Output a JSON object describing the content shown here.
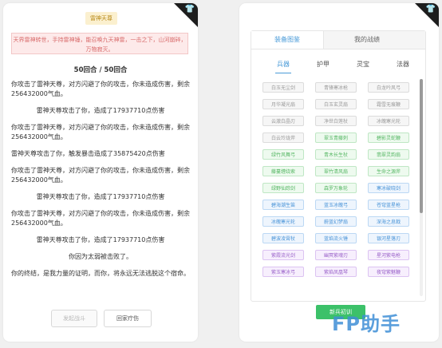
{
  "left": {
    "title": "雷神天尊",
    "banner": "天界雷神转世，手持雷神锤，能召唤九天神雷，一击之下，山河崩碎，万物寂灭。",
    "round": "50回合 / 50回合",
    "log": [
      "你攻击了雷神天尊，对方闪避了你的攻击，你未造成伤害，剩余256432000气血。",
      "雷神天尊攻击了你，造成了17937710点伤害",
      "你攻击了雷神天尊，对方闪避了你的攻击，你未造成伤害，剩余256432000气血。",
      "雷神天尊攻击了你，触发暴击造成了35875420点伤害",
      "你攻击了雷神天尊，对方闪避了你的攻击，你未造成伤害，剩余256432000气血。",
      "雷神天尊攻击了你，造成了17937710点伤害",
      "你攻击了雷神天尊，对方闪避了你的攻击，你未造成伤害，剩余256432000气血。",
      "雷神天尊攻击了你，造成了17937710点伤害",
      "你因为太弱被击败了。",
      "你的终结，是我力量的证明，而你，将永远无法逃脱这个宿命。"
    ],
    "buttons": {
      "attack": "发起战斗",
      "back": "回家疗伤"
    }
  },
  "right": {
    "top_tabs": [
      "装备图鉴",
      "我的战绩"
    ],
    "sub_tabs": [
      "兵器",
      "护甲",
      "灵宝",
      "法器"
    ],
    "items": [
      {
        "label": "白玉无尘剑",
        "tier": "white"
      },
      {
        "label": "青锋寒冰枪",
        "tier": "white"
      },
      {
        "label": "白龙吟风弓",
        "tier": "white"
      },
      {
        "label": "月华凝光扇",
        "tier": "white"
      },
      {
        "label": "白玉玄灵扇",
        "tier": "white"
      },
      {
        "label": "霜雪无痕鞭",
        "tier": "white"
      },
      {
        "label": "云澈白晶刃",
        "tier": "white"
      },
      {
        "label": "净世白莲杖",
        "tier": "white"
      },
      {
        "label": "冰魄寒光轮",
        "tier": "white"
      },
      {
        "label": "白云玲珑斧",
        "tier": "white"
      },
      {
        "label": "翠玉青藤刺",
        "tier": "green"
      },
      {
        "label": "碧影灵蛇鞭",
        "tier": "green"
      },
      {
        "label": "绿竹风舞弓",
        "tier": "green"
      },
      {
        "label": "青木长生杖",
        "tier": "green"
      },
      {
        "label": "翡翠灵韵扇",
        "tier": "green"
      },
      {
        "label": "藤蔓缠绕索",
        "tier": "green"
      },
      {
        "label": "翠竹清风扇",
        "tier": "green"
      },
      {
        "label": "生命之源斧",
        "tier": "green"
      },
      {
        "label": "绿野仙踪剑",
        "tier": "green"
      },
      {
        "label": "森罗万象轮",
        "tier": "green"
      },
      {
        "label": "寒冰破晓剑",
        "tier": "blue"
      },
      {
        "label": "碧海潮生笛",
        "tier": "blue"
      },
      {
        "label": "蓝玉冰魄弓",
        "tier": "blue"
      },
      {
        "label": "苍穹蓝星枪",
        "tier": "blue"
      },
      {
        "label": "冰魄寒光轮",
        "tier": "blue"
      },
      {
        "label": "蔚蓝幻梦扇",
        "tier": "blue"
      },
      {
        "label": "深海之息戟",
        "tier": "blue"
      },
      {
        "label": "碧波凌霄杖",
        "tier": "blue"
      },
      {
        "label": "蓝焰流火锤",
        "tier": "blue"
      },
      {
        "label": "银河星落刃",
        "tier": "blue"
      },
      {
        "label": "紫霞流光剑",
        "tier": "purple"
      },
      {
        "label": "幽冥紫魂刃",
        "tier": "purple"
      },
      {
        "label": "星河紫电枪",
        "tier": "purple"
      },
      {
        "label": "紫玉寒冰弓",
        "tier": "purple"
      },
      {
        "label": "紫焰凤凰琴",
        "tier": "purple"
      },
      {
        "label": "夜穹紫魅鞭",
        "tier": "purple"
      }
    ],
    "green_button": "新兵初训",
    "watermark": "FP助手"
  },
  "colors": {
    "white": {
      "bg": "#f6f6f6",
      "border": "#dcdcdc",
      "text": "#9a9a9a"
    },
    "green": {
      "bg": "#eefaef",
      "border": "#bfe7c4",
      "text": "#58b866"
    },
    "blue": {
      "bg": "#eef5fd",
      "border": "#bcd8f4",
      "text": "#4a94d8"
    },
    "purple": {
      "bg": "#f7effd",
      "border": "#dcc3f2",
      "text": "#9a62c9"
    }
  }
}
